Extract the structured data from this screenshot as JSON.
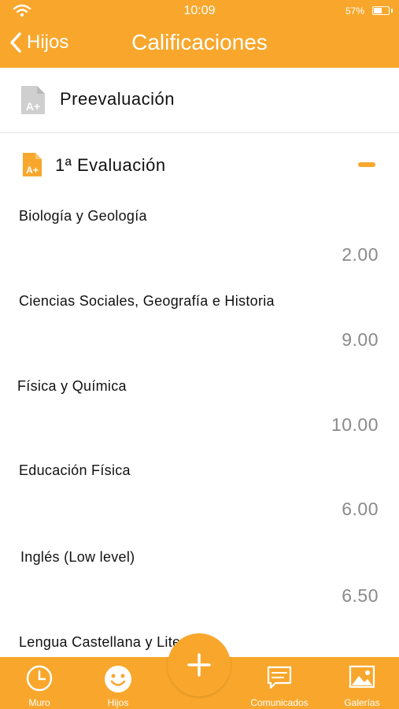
{
  "status": {
    "time": "10:09",
    "battery": "57%",
    "battery_level": 0.57
  },
  "header": {
    "back_label": "Hijos",
    "title": "Calificaciones"
  },
  "sections": {
    "pre": {
      "label": "Preevaluación"
    },
    "eval1": {
      "label": "1ª Evaluación"
    }
  },
  "subjects": [
    {
      "name": "Biología y Geología",
      "grade": "2.00"
    },
    {
      "name": "Ciencias Sociales, Geografía e Historia",
      "grade": "9.00"
    },
    {
      "name": "Física y Química",
      "grade": "10.00"
    },
    {
      "name": "Educación Física",
      "grade": "6.00"
    },
    {
      "name": "Inglés (Low level)",
      "grade": "6.50"
    },
    {
      "name": "Lengua Castellana y Literatura",
      "grade": ""
    }
  ],
  "tabs": {
    "muro": "Muro",
    "hijos": "Hijos",
    "comunicados": "Comunicados",
    "galerias": "Galerías"
  },
  "colors": {
    "accent": "#f8a72c",
    "grade": "#8a8a8a"
  }
}
